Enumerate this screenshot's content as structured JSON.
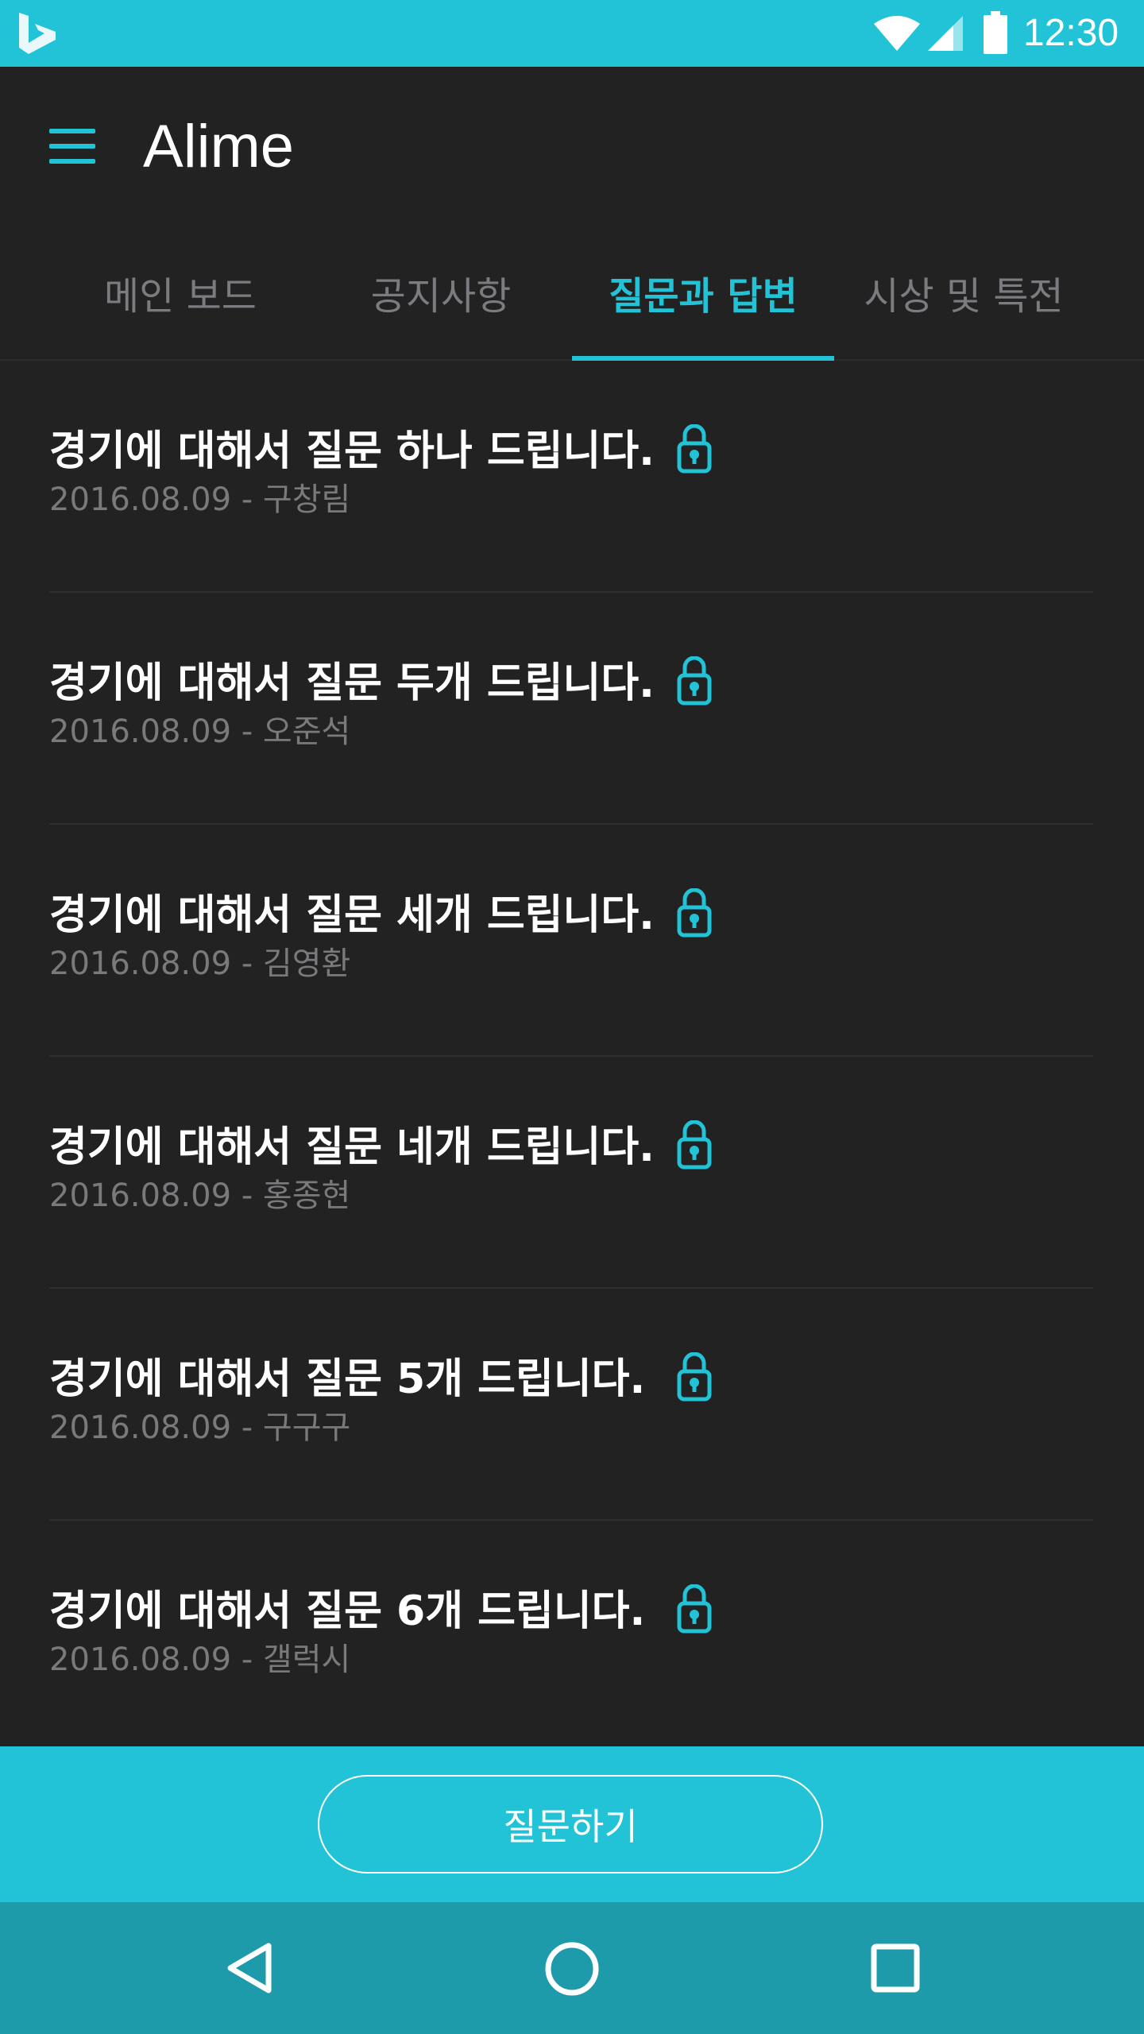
{
  "status_bar": {
    "time": "12:30",
    "color": "#22c3d6"
  },
  "app_bar": {
    "title": "Alime"
  },
  "tabs": [
    {
      "label": "메인 보드",
      "active": false
    },
    {
      "label": "공지사항",
      "active": false
    },
    {
      "label": "질문과 답변",
      "active": true
    },
    {
      "label": "시상 및 특전",
      "active": false
    }
  ],
  "questions": [
    {
      "title": "경기에 대해서 질문 하나 드립니다.",
      "date": "2016.08.09",
      "separator": " - ",
      "author": "구창림",
      "locked": true
    },
    {
      "title": "경기에 대해서 질문 두개 드립니다.",
      "date": "2016.08.09",
      "separator": " - ",
      "author": "오준석",
      "locked": true
    },
    {
      "title": "경기에 대해서 질문 세개 드립니다.",
      "date": "2016.08.09",
      "separator": " - ",
      "author": "김영환",
      "locked": true
    },
    {
      "title": "경기에 대해서 질문 네개 드립니다.",
      "date": "2016.08.09",
      "separator": " - ",
      "author": "홍종현",
      "locked": true
    },
    {
      "title": "경기에 대해서 질문 5개 드립니다.",
      "date": "2016.08.09",
      "separator": " - ",
      "author": "구구구",
      "locked": true
    },
    {
      "title": "경기에 대해서 질문 6개 드립니다.",
      "date": "2016.08.09",
      "separator": " - ",
      "author": "갤럭시",
      "locked": true
    }
  ],
  "action": {
    "ask_label": "질문하기"
  },
  "colors": {
    "accent": "#22c3d6",
    "background": "#222223",
    "nav_bar": "#1e9baa"
  },
  "icons": [
    "bing-logo-icon",
    "wifi-icon",
    "signal-icon",
    "battery-icon",
    "menu-icon",
    "lock-icon",
    "back-icon",
    "home-icon",
    "recents-icon"
  ]
}
